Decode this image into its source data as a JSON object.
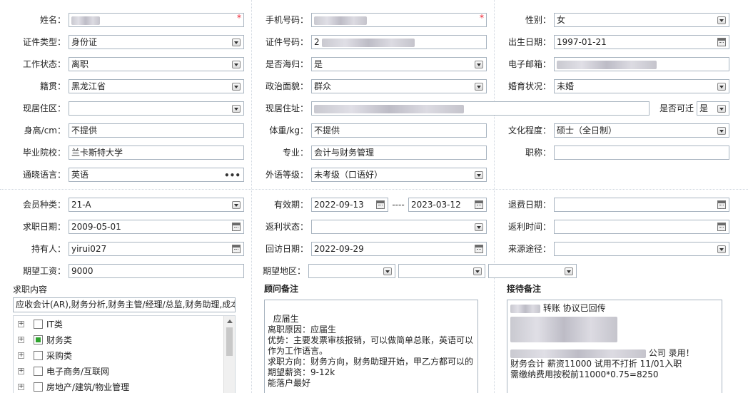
{
  "basic": {
    "name": {
      "label": "姓名：",
      "value": ""
    },
    "phone": {
      "label": "手机号码：",
      "value": ""
    },
    "gender": {
      "label": "性别：",
      "value": "女"
    },
    "id_type": {
      "label": "证件类型：",
      "value": "身份证"
    },
    "id_no": {
      "label": "证件号码：",
      "value": "2"
    },
    "birth": {
      "label": "出生日期：",
      "value": "1997-01-21"
    },
    "work_status": {
      "label": "工作状态：",
      "value": "离职"
    },
    "returnee": {
      "label": "是否海归：",
      "value": "是"
    },
    "email": {
      "label": "电子邮箱：",
      "value": ""
    },
    "native": {
      "label": "籍贯：",
      "value": "黑龙江省"
    },
    "political": {
      "label": "政治面貌：",
      "value": "群众"
    },
    "marital": {
      "label": "婚育状况：",
      "value": "未婚"
    },
    "residence_area": {
      "label": "现居住区：",
      "value": ""
    },
    "residence_addr": {
      "label": "现居住址：",
      "value": ""
    },
    "relocate": {
      "label": "是否可迁",
      "value": "是"
    },
    "height": {
      "label": "身高/cm：",
      "value": "不提供"
    },
    "weight": {
      "label": "体重/kg：",
      "value": "不提供"
    },
    "education": {
      "label": "文化程度：",
      "value": "硕士（全日制）"
    },
    "school": {
      "label": "毕业院校：",
      "value": "兰卡斯特大学"
    },
    "major": {
      "label": "专业：",
      "value": "会计与财务管理"
    },
    "title": {
      "label": "职称：",
      "value": ""
    },
    "language": {
      "label": "通晓语言：",
      "value": "英语",
      "more": "•••"
    },
    "lang_level": {
      "label": "外语等级：",
      "value": "未考级（口语好）"
    }
  },
  "membership": {
    "member_type": {
      "label": "会员种类：",
      "value": "21-A"
    },
    "valid": {
      "label": "有效期：",
      "from": "2022-09-13",
      "sep": "----",
      "to": "2023-03-12"
    },
    "refund_date": {
      "label": "退费日期：",
      "value": ""
    },
    "job_date": {
      "label": "求职日期：",
      "value": "2009-05-01"
    },
    "rebate_status": {
      "label": "返利状态：",
      "value": ""
    },
    "rebate_time": {
      "label": "返利时间：",
      "value": ""
    },
    "holder": {
      "label": "持有人：",
      "value": "yirui027"
    },
    "visit_date": {
      "label": "回访日期：",
      "value": "2022-09-29"
    },
    "source": {
      "label": "来源途径：",
      "value": ""
    },
    "salary": {
      "label": "期望工资：",
      "value": "9000"
    },
    "region": {
      "label": "期望地区：",
      "v1": "",
      "v2": "",
      "v3": ""
    }
  },
  "job_content": {
    "title": "求职内容",
    "summary": "应收会计(AR),财务分析,财务主管/经理/总监,财务助理,成本",
    "tree": [
      {
        "label": "IT类",
        "checked": false
      },
      {
        "label": "财务类",
        "checked": true
      },
      {
        "label": "采购类",
        "checked": false
      },
      {
        "label": "电子商务/互联网",
        "checked": false
      },
      {
        "label": "房地产/建筑/物业管理",
        "checked": false
      }
    ]
  },
  "advisor": {
    "title": "顾问备注",
    "text": "应届生\n离职原因：应届生\n优势：主要发票审核报销，可以做简单总账，英语可以作为工作语言。\n求职方向：财务方向，财务助理开始，甲乙方都可以的\n期望薪资：9-12k\n能落户最好"
  },
  "reception": {
    "title": "接待备注",
    "line1": "转账 协议已回传",
    "line2": "公司 录用！",
    "line3": "财务会计 薪资11000 试用不打折 11/01入职",
    "line4": "需缴纳费用按税前11000*0.75=8250"
  }
}
